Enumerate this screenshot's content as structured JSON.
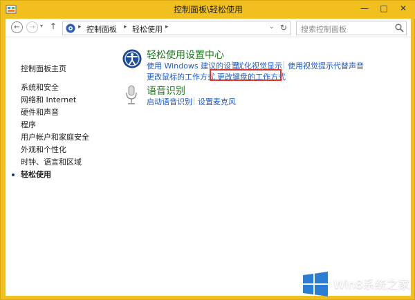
{
  "window": {
    "title": "控制面板\\轻松使用",
    "minimize": "—",
    "maximize": "□",
    "close": "✕"
  },
  "nav": {
    "back_glyph": "←",
    "forward_glyph": "→",
    "recent_glyph": "▾",
    "up_glyph": "↑",
    "breadcrumb": [
      "控制面板",
      "轻松使用"
    ],
    "separator": "▸",
    "dropdown_glyph": "⌄",
    "refresh_glyph": "↻"
  },
  "search": {
    "placeholder": "搜索控制面板"
  },
  "sidebar": {
    "home": "控制面板主页",
    "items": [
      "系统和安全",
      "网络和 Internet",
      "硬件和声音",
      "程序",
      "用户帐户和家庭安全",
      "外观和个性化",
      "时钟、语言和区域",
      "轻松使用"
    ],
    "current": "轻松使用"
  },
  "main": {
    "ease_center": {
      "title": "轻松使用设置中心",
      "links": [
        "使用 Windows 建议的设置",
        "优化视觉显示",
        "使用视觉提示代替声音",
        "更改鼠标的工作方式",
        "更改键盘的工作方式"
      ]
    },
    "speech": {
      "title": "语音识别",
      "links": [
        "启动语音识别",
        "设置麦克风"
      ]
    }
  },
  "watermark": {
    "text": "Win8系统之家"
  },
  "colors": {
    "frame": "#f2c01e",
    "link": "#1e5bc6",
    "section_title": "#1e7a1e",
    "highlight": "#e0312c"
  }
}
